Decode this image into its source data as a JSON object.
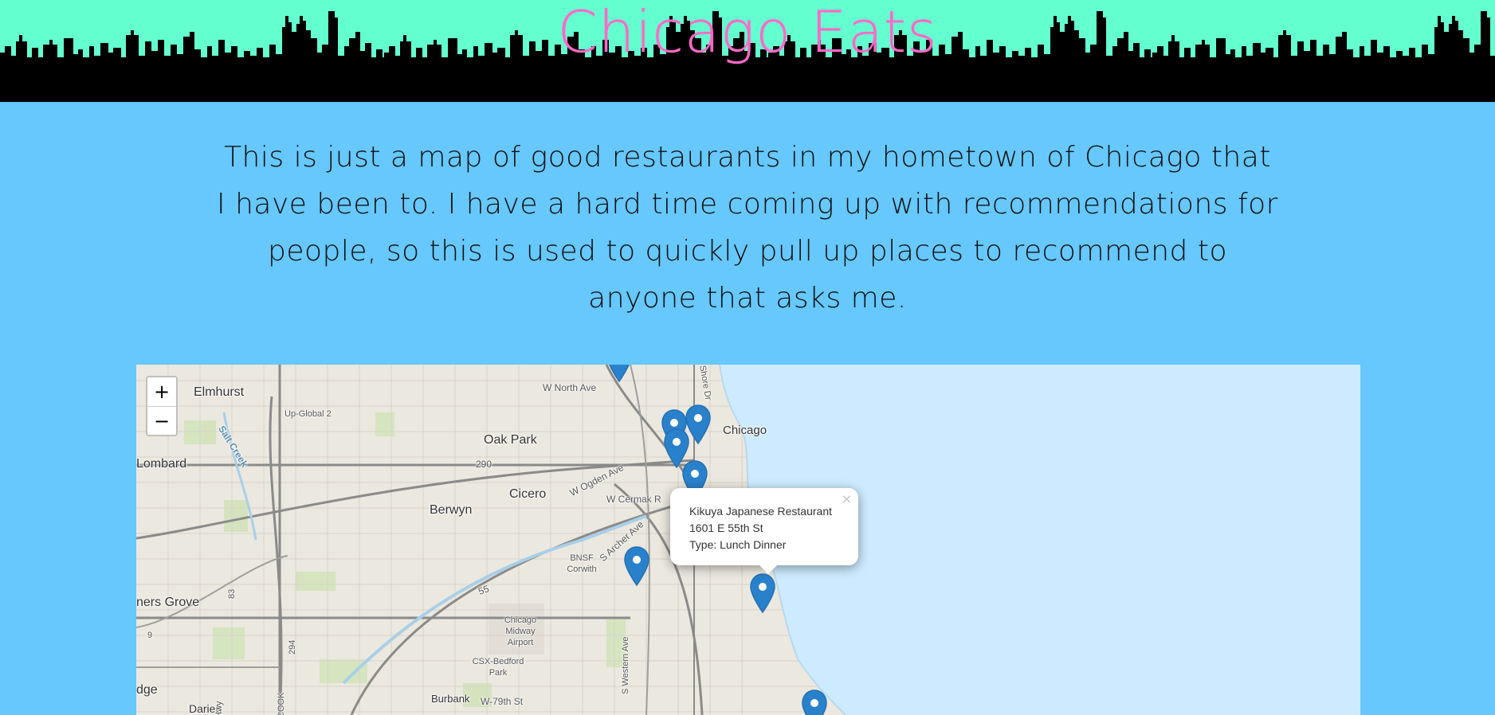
{
  "header": {
    "title": "Chicago Eats"
  },
  "intro": {
    "text": "This is just a map of good restaurants in my hometown of Chicago that I have been to. I have a hard time coming up with recommendations for people, so this is used to quickly pull up places to recommend to anyone that asks me."
  },
  "colors": {
    "header_bg": "#64ffcf",
    "page_bg": "#66c8fd",
    "title": "#ff69c8",
    "marker": "#2a81cb",
    "lake": "#cdeafe"
  },
  "map": {
    "zoom_in_label": "+",
    "zoom_out_label": "−",
    "labels": {
      "elmhurst": "Elmhurst",
      "up_global": "Up-Global 2",
      "w_north_ave": "W North Ave",
      "chicago": "Chicago",
      "oak_park": "Oak Park",
      "lombard": "Lombard",
      "salt_creek": "Salt Creek",
      "route_290": "290",
      "w_ogden_ave": "W Ogden Ave",
      "cicero": "Cicero",
      "w_cermak": "W Cermak R",
      "berwyn": "Berwyn",
      "s_archer_ave": "S Archer Ave",
      "bnsf_corwith": "BNSF Corwith",
      "route_55": "55",
      "downers_grove": "ners Grove",
      "route_83": "83",
      "route_294": "294",
      "chicago_midway": "Chicago Midway Airport",
      "csx_bedford": "CSX-Bedford Park",
      "s_western_ave": "S Western Ave",
      "burbank": "Burbank",
      "w_79th_st": "W-79th St",
      "edge": "dge",
      "darien": "Darien",
      "cook": "COOK",
      "hwy": "Hwy",
      "route_9": "9",
      "shore_dr": "Shore Dr"
    },
    "popup": {
      "close_label": "×",
      "name": "Kikuya Japanese Restaurant",
      "address": "1601 E 55th St",
      "type": "Type: Lunch Dinner"
    },
    "marker_icon": "map-marker-icon"
  }
}
